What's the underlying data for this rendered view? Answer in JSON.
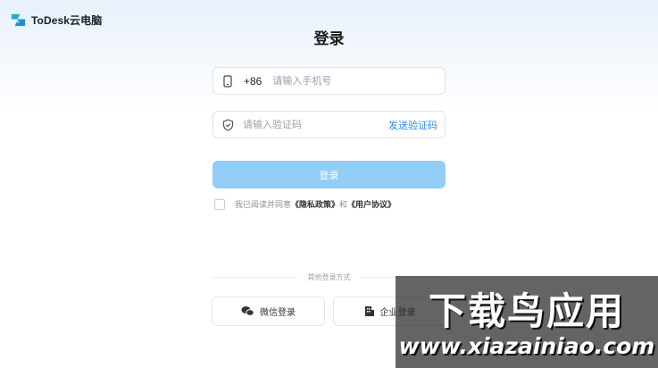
{
  "brand": {
    "name": "ToDesk云电脑",
    "logo_icon": "todesk-logo-icon"
  },
  "page": {
    "title": "登录"
  },
  "phone_field": {
    "country_code": "+86",
    "placeholder": "请输入手机号",
    "value": "",
    "icon": "phone-icon"
  },
  "code_field": {
    "placeholder": "请输入验证码",
    "value": "",
    "icon": "shield-icon",
    "send_label": "发送验证码"
  },
  "login_button": {
    "label": "登录"
  },
  "agreement": {
    "prefix": "我已阅读并同意",
    "privacy": "《隐私政策》",
    "and": "和",
    "terms": "《用户协议》",
    "checked": false
  },
  "other_login": {
    "label": "其他登录方式",
    "wechat": {
      "label": "微信登录",
      "icon": "wechat-icon"
    },
    "enterprise": {
      "label": "企业登录",
      "icon": "building-icon"
    }
  },
  "watermark": {
    "cn": "下载鸟应用",
    "en": "www.xiazainiao.com"
  },
  "colors": {
    "primary": "#2f8ef2",
    "button_disabled": "#91cdf7",
    "brand_teal": "#17b3c8"
  }
}
